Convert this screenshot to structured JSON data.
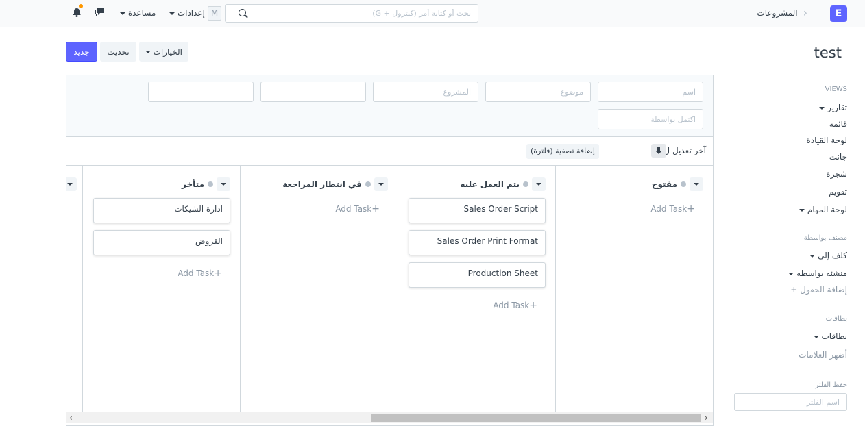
{
  "navbar": {
    "logo_letter": "E",
    "breadcrumb": "المشروعات",
    "search_placeholder": "بحث أو كتابة أمر (كنترول + G)",
    "settings_label": "إعدادات",
    "help_label": "مساعدة",
    "avatar_letter": "M",
    "notification_color": "#ff9800"
  },
  "page": {
    "title": "test",
    "options_label": "الخيارات",
    "refresh_label": "تحديث",
    "new_label": "جديد"
  },
  "sidebar": {
    "views_heading": "VIEWS",
    "views": [
      "تقارير",
      "قائمة",
      "لوحة القيادة",
      "جانت",
      "شجرة",
      "تقويم",
      "لوحة المهام"
    ],
    "group_by_heading": "مصنف بواسطة",
    "assigned_to": "كلف إلى",
    "created_by": "منشئه بواسطه",
    "add_fields": "إضافة الحقول",
    "tags_heading": "بطاقات",
    "tags": "بطاقات",
    "show_tags": "أضهر العلامات",
    "save_filter_heading": "حفظ الفلتر",
    "filter_name_placeholder": "اسم الفلتر"
  },
  "filters": {
    "name_placeholder": "اسم",
    "subject_placeholder": "موضوع",
    "project_placeholder": "المشروع",
    "completed_by_placeholder": "اكتمل بواسطة"
  },
  "sort": {
    "label": "آخر تعديل ل",
    "add_filter": "إضافة تصفية (فلترة)"
  },
  "board": {
    "add_task_label": "Add Task",
    "columns": [
      {
        "title": "مفتوح",
        "cards": []
      },
      {
        "title": "يتم العمل عليه",
        "cards": [
          "Sales Order Script",
          "Sales Order Print Format",
          "Production Sheet"
        ]
      },
      {
        "title": "في انتظار المراجعة",
        "cards": []
      },
      {
        "title": "متأخر",
        "cards": [
          "ادارة الشيكات",
          "القروض"
        ]
      }
    ]
  }
}
